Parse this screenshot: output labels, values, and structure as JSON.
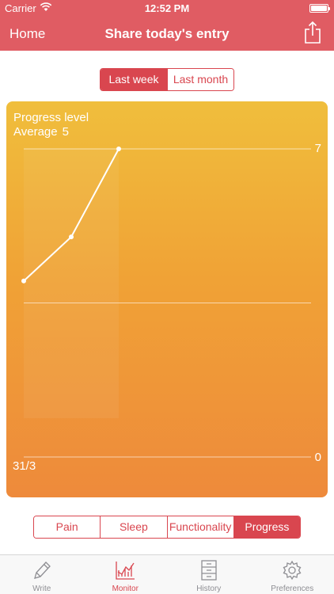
{
  "status": {
    "carrier": "Carrier",
    "time": "12:52 PM"
  },
  "nav": {
    "back_label": "Home",
    "title": "Share today's entry"
  },
  "period": {
    "options": [
      "Last week",
      "Last month"
    ],
    "selected": 0
  },
  "chart_data": {
    "type": "line",
    "title": "Progress level",
    "average_label": "Average",
    "average_value": "5",
    "x_start_label": "31/3",
    "y_max_label": "7",
    "y_min_label": "0",
    "ylim": [
      0,
      7
    ],
    "series": [
      {
        "values": [
          4,
          5,
          7
        ]
      }
    ],
    "grid": true
  },
  "metrics": {
    "options": [
      "Pain",
      "Sleep",
      "Functionality",
      "Progress"
    ],
    "selected": 3
  },
  "tabs": [
    {
      "label": "Write",
      "icon": "pencil-icon"
    },
    {
      "label": "Monitor",
      "icon": "chart-icon"
    },
    {
      "label": "History",
      "icon": "cabinet-icon"
    },
    {
      "label": "Preferences",
      "icon": "gear-icon"
    }
  ],
  "colors": {
    "accent": "#D9464F",
    "nav_bg": "#E05C63",
    "chart_top": "#F0BE3C",
    "chart_bottom": "#EE8A3B"
  }
}
